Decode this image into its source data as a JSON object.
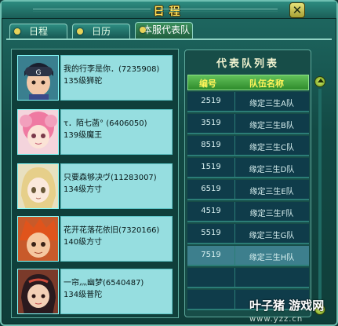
{
  "window": {
    "title": "日程",
    "close_label": "✕"
  },
  "tabs": [
    {
      "label": "日程",
      "active": false
    },
    {
      "label": "日历",
      "active": false
    },
    {
      "label": "本服代表队",
      "active": true
    }
  ],
  "members": [
    {
      "name": "我的行李是你．(7235908)",
      "level": "135级狮驼",
      "avatar": "boy-cap-avatar"
    },
    {
      "name": "τ．陌七菡° (6406050)",
      "level": "139级魔王",
      "avatar": "pink-hair-avatar"
    },
    {
      "name": "只要森够决ヴ(11283007)",
      "level": "134级方寸",
      "avatar": "blonde-girl-avatar"
    },
    {
      "name": "花开花落花依旧(7320166)",
      "level": "140级方寸",
      "avatar": "red-hair-avatar"
    },
    {
      "name": "一帘灬幽梦(6540487)",
      "level": "134级普陀",
      "avatar": "dark-hair-avatar"
    }
  ],
  "team_list": {
    "title": "代表队列表",
    "columns": [
      "编号",
      "队伍名称"
    ],
    "rows": [
      {
        "id": "2519",
        "name": "缘定三生A队"
      },
      {
        "id": "3519",
        "name": "缘定三生B队"
      },
      {
        "id": "8519",
        "name": "缘定三生C队"
      },
      {
        "id": "1519",
        "name": "缘定三生D队"
      },
      {
        "id": "6519",
        "name": "缘定三生E队"
      },
      {
        "id": "4519",
        "name": "缘定三生F队"
      },
      {
        "id": "5519",
        "name": "缘定三生G队"
      },
      {
        "id": "7519",
        "name": "缘定三生H队"
      },
      {
        "id": "",
        "name": ""
      },
      {
        "id": "",
        "name": ""
      }
    ],
    "selected_row": 7
  },
  "watermark": {
    "logo": "叶子猪 游戏网",
    "url": "www.yzz.cn"
  },
  "colors": {
    "accent": "#ffe35a",
    "panel": "#96dee0",
    "header": "#4fb34a"
  }
}
